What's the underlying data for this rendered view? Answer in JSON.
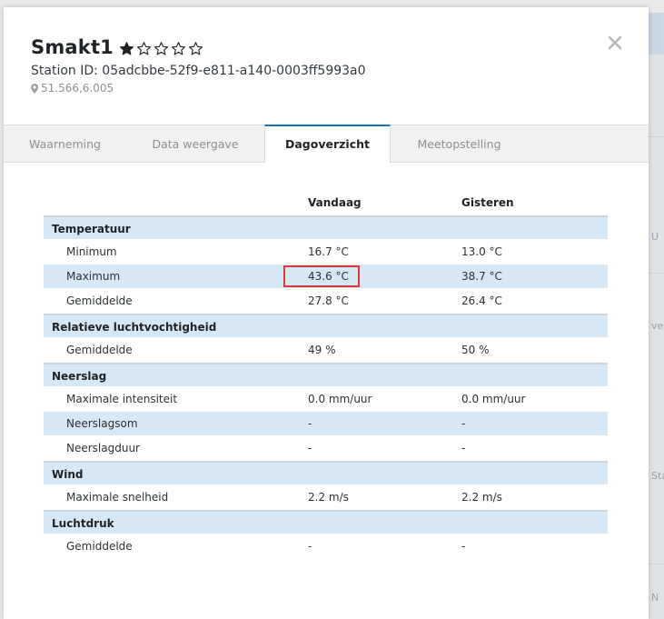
{
  "station": {
    "name": "Smakt1",
    "rating": 1,
    "rating_max": 5,
    "station_id": "Station ID: 05adcbbe-52f9-e811-a140-0003ff5993a0",
    "coordinates": "51.566,6.005"
  },
  "close_icon": "×",
  "tabs": [
    {
      "label": "Waarneming",
      "active": false
    },
    {
      "label": "Data weergave",
      "active": false
    },
    {
      "label": "Dagoverzicht",
      "active": true
    },
    {
      "label": "Meetopstelling",
      "active": false
    }
  ],
  "table": {
    "headers": {
      "today": "Vandaag",
      "yesterday": "Gisteren"
    },
    "sections": [
      {
        "title": "Temperatuur",
        "rows": [
          {
            "label": "Minimum",
            "today": "16.7 °C",
            "yesterday": "13.0 °C"
          },
          {
            "label": "Maximum",
            "today": "43.6 °C",
            "yesterday": "38.7 °C"
          },
          {
            "label": "Gemiddelde",
            "today": "27.8 °C",
            "yesterday": "26.4 °C"
          }
        ]
      },
      {
        "title": "Relatieve luchtvochtigheid",
        "rows": [
          {
            "label": "Gemiddelde",
            "today": "49 %",
            "yesterday": "50 %"
          }
        ]
      },
      {
        "title": "Neerslag",
        "rows": [
          {
            "label": "Maximale intensiteit",
            "today": "0.0 mm/uur",
            "yesterday": "0.0 mm/uur"
          },
          {
            "label": "Neerslagsom",
            "today": "-",
            "yesterday": "-"
          },
          {
            "label": "Neerslagduur",
            "today": "-",
            "yesterday": "-"
          }
        ]
      },
      {
        "title": "Wind",
        "rows": [
          {
            "label": "Maximale snelheid",
            "today": "2.2 m/s",
            "yesterday": "2.2 m/s"
          }
        ]
      },
      {
        "title": "Luchtdruk",
        "rows": [
          {
            "label": "Gemiddelde",
            "today": "-",
            "yesterday": "-"
          }
        ]
      }
    ]
  },
  "map_labels": [
    "U",
    "vel",
    "Sta",
    "N"
  ],
  "colors": {
    "accent": "#1a74b8",
    "section_bg": "#d6e7f5",
    "highlight": "#d9393b"
  }
}
